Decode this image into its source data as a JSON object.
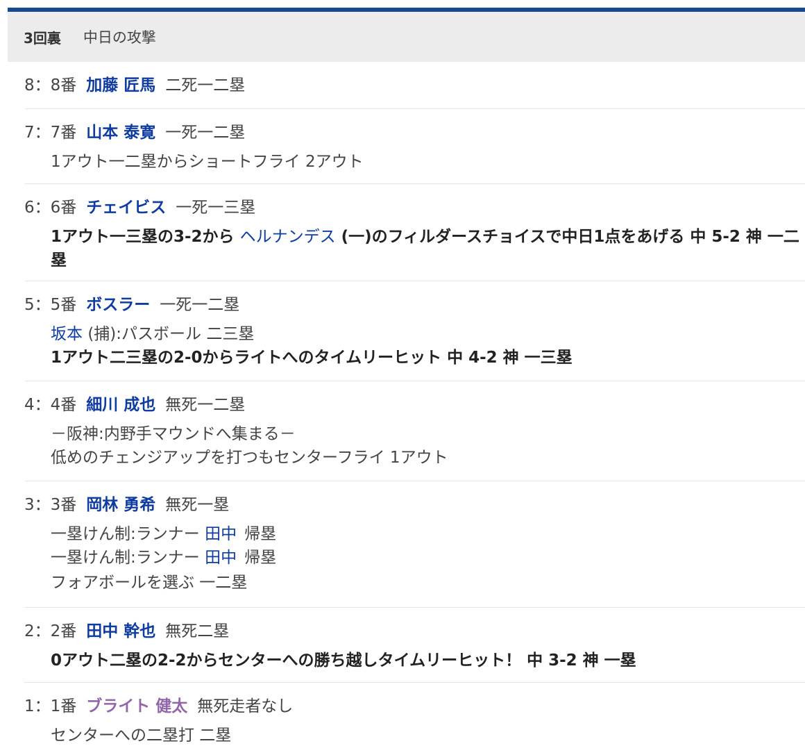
{
  "header": {
    "inning": "3回裏",
    "team": "中日の攻撃"
  },
  "plays": [
    {
      "order": "8：8番",
      "batter": "加藤 匠馬",
      "situation": "二死一二塁",
      "lines": []
    },
    {
      "order": "7：7番",
      "batter": "山本 泰寛",
      "situation": "一死一二塁",
      "lines": [
        {
          "text": "1アウト一二塁からショートフライ 2アウト"
        }
      ]
    },
    {
      "order": "6：6番",
      "batter": "チェイビス",
      "situation": "一死一三塁",
      "lines": [
        {
          "prefix": "1アウト一三塁の3-2から",
          "link": "ヘルナンデス",
          "suffix": "(一)のフィルダースチョイスで中日1点をあげる 中 5-2 神 一二塁"
        }
      ]
    },
    {
      "order": "5：5番",
      "batter": "ボスラー",
      "situation": "一死一二塁",
      "lines": [
        {
          "link": "坂本",
          "suffix": "(捕):パスボール 二三塁"
        },
        {
          "text": "1アウト二三塁の2-0からライトへのタイムリーヒット 中 4-2 神 一三塁"
        }
      ]
    },
    {
      "order": "4：4番",
      "batter": "細川 成也",
      "situation": "無死一二塁",
      "lines": [
        {
          "text": "－阪神:内野手マウンドへ集まる－"
        },
        {
          "text": "低めのチェンジアップを打つもセンターフライ 1アウト"
        }
      ]
    },
    {
      "order": "3：3番",
      "batter": "岡林 勇希",
      "situation": "無死一塁",
      "lines": [
        {
          "prefix": "一塁けん制:ランナー",
          "link": "田中",
          "suffix": "帰塁"
        },
        {
          "prefix": "一塁けん制:ランナー",
          "link": "田中",
          "suffix": "帰塁"
        },
        {
          "text": "フォアボールを選ぶ 一二塁"
        }
      ]
    },
    {
      "order": "2：2番",
      "batter": "田中 幹也",
      "situation": "無死二塁",
      "lines": [
        {
          "text": "0アウト二塁の2-2からセンターへの勝ち越しタイムリーヒット！ 中 3-2 神 一塁"
        }
      ]
    },
    {
      "order": "1：1番",
      "batter": "ブライト 健太",
      "situation": "無死走者なし",
      "lines": [
        {
          "text": "センターへの二塁打 二塁"
        }
      ]
    }
  ],
  "colors": {
    "accent_bar": "#154b8e",
    "header_bg": "#ececec",
    "player_link": "#0f3ca0",
    "player_link_visited": "#9166a9"
  }
}
